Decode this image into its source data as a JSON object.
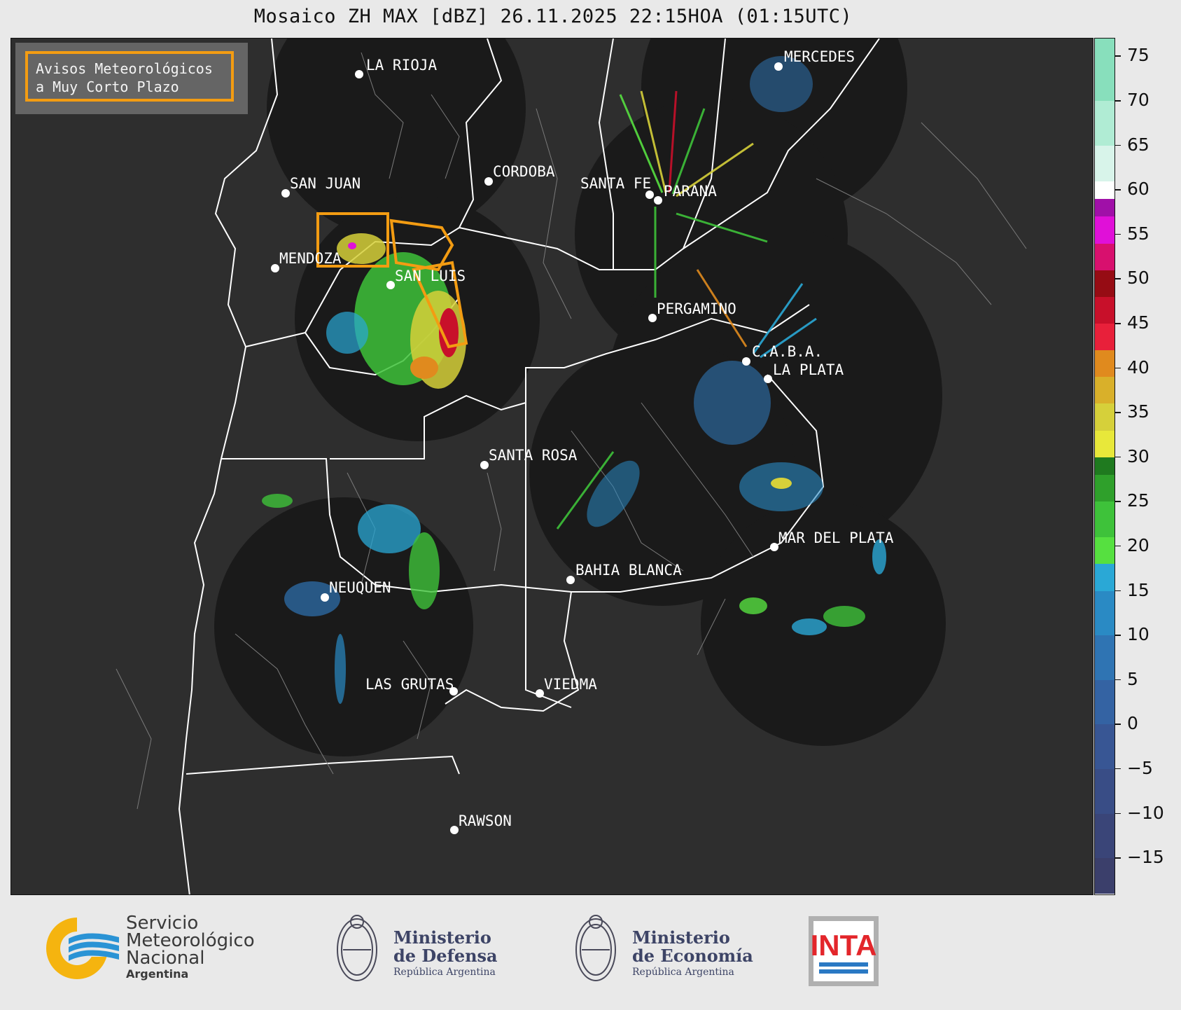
{
  "title": "Mosaico ZH MAX [dBZ] 26.11.2025 22:15HOA (01:15UTC)",
  "avisos": {
    "line1": "Avisos Meteorológicos",
    "line2": "a Muy Corto Plazo",
    "border_color": "#f39c12"
  },
  "cities": {
    "la_rioja": "LA RIOJA",
    "san_juan": "SAN JUAN",
    "cordoba": "CORDOBA",
    "santa_fe": "SANTA FE",
    "parana": "PARANA",
    "mendoza": "MENDOZA",
    "san_luis": "SAN LUIS",
    "pergamino": "PERGAMINO",
    "caba": "C.A.B.A.",
    "la_plata": "LA PLATA",
    "mercedes": "MERCEDES",
    "santa_rosa": "SANTA ROSA",
    "mar_del_plata": "MAR DEL PLATA",
    "bahia_blanca": "BAHIA BLANCA",
    "neuquen": "NEUQUEN",
    "las_grutas": "LAS GRUTAS",
    "viedma": "VIEDMA",
    "rawson": "RAWSON"
  },
  "colorbar": {
    "unit": "dBZ",
    "min": -19,
    "max": 77,
    "ticks": [
      "75",
      "70",
      "65",
      "60",
      "55",
      "50",
      "45",
      "40",
      "35",
      "30",
      "25",
      "20",
      "15",
      "10",
      "5",
      "0",
      "−5",
      "−10",
      "−15"
    ],
    "bands": [
      {
        "from": -19,
        "to": -15,
        "color": "#3b3f6b"
      },
      {
        "from": -15,
        "to": -10,
        "color": "#3a4578"
      },
      {
        "from": -10,
        "to": -5,
        "color": "#394d86"
      },
      {
        "from": -5,
        "to": 0,
        "color": "#385694"
      },
      {
        "from": 0,
        "to": 5,
        "color": "#3463a3"
      },
      {
        "from": 5,
        "to": 10,
        "color": "#2f74b3"
      },
      {
        "from": 10,
        "to": 15,
        "color": "#2a8ac4"
      },
      {
        "from": 15,
        "to": 18,
        "color": "#2aa8d6"
      },
      {
        "from": 18,
        "to": 21,
        "color": "#56e040"
      },
      {
        "from": 21,
        "to": 25,
        "color": "#3ec23a"
      },
      {
        "from": 25,
        "to": 28,
        "color": "#2fa02b"
      },
      {
        "from": 28,
        "to": 30,
        "color": "#1f7a1f"
      },
      {
        "from": 30,
        "to": 33,
        "color": "#e8e83a"
      },
      {
        "from": 33,
        "to": 36,
        "color": "#d6d03a"
      },
      {
        "from": 36,
        "to": 39,
        "color": "#d9b02a"
      },
      {
        "from": 39,
        "to": 42,
        "color": "#e08a1e"
      },
      {
        "from": 42,
        "to": 45,
        "color": "#e8203a"
      },
      {
        "from": 45,
        "to": 48,
        "color": "#c8102a"
      },
      {
        "from": 48,
        "to": 51,
        "color": "#960c14"
      },
      {
        "from": 51,
        "to": 54,
        "color": "#d8106e"
      },
      {
        "from": 54,
        "to": 57,
        "color": "#e010d8"
      },
      {
        "from": 57,
        "to": 59,
        "color": "#a010a8"
      },
      {
        "from": 59,
        "to": 61,
        "color": "#ffffff"
      },
      {
        "from": 61,
        "to": 65,
        "color": "#d8f4ea"
      },
      {
        "from": 65,
        "to": 70,
        "color": "#b0ecd4"
      },
      {
        "from": 70,
        "to": 77,
        "color": "#88dfbc"
      }
    ]
  },
  "footer": {
    "smn": {
      "line1": "Servicio",
      "line2": "Meteorológico",
      "line3": "Nacional",
      "line4": "Argentina"
    },
    "defensa": {
      "line1": "Ministerio",
      "line2": "de Defensa",
      "line3": "República Argentina"
    },
    "economia": {
      "line1": "Ministerio",
      "line2": "de Economía",
      "line3": "República Argentina"
    },
    "inta": {
      "label": "INTA",
      "color": "#e3262b"
    }
  }
}
